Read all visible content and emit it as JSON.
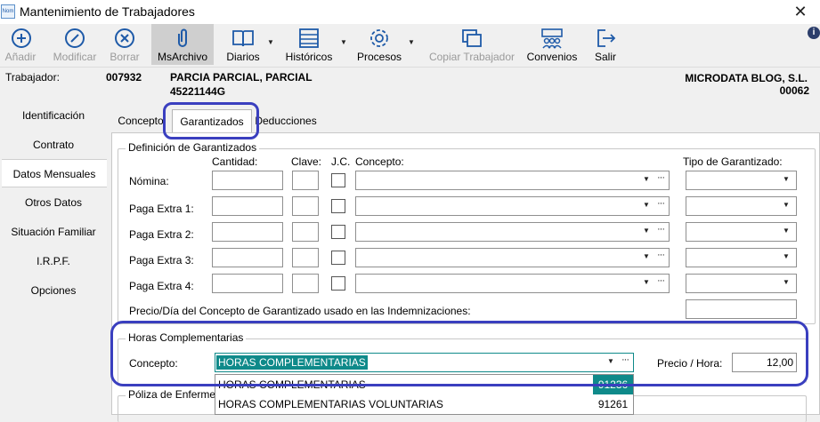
{
  "window": {
    "app_icon_text": "Nom",
    "title": "Mantenimiento de Trabajadores"
  },
  "toolbar": {
    "buttons": [
      {
        "label": "Añadir",
        "icon": "plus-circle-icon",
        "enabled": false
      },
      {
        "label": "Modificar",
        "icon": "pencil-icon",
        "enabled": false
      },
      {
        "label": "Borrar",
        "icon": "x-circle-icon",
        "enabled": false
      },
      {
        "label": "MsArchivo",
        "icon": "paperclip-icon",
        "enabled": true
      },
      {
        "label": "Diarios",
        "icon": "book-icon",
        "enabled": true
      },
      {
        "label": "Históricos",
        "icon": "list-icon",
        "enabled": true
      },
      {
        "label": "Procesos",
        "icon": "gear-icon",
        "enabled": true
      },
      {
        "label": "Copiar Trabajador",
        "icon": "copy-icon",
        "enabled": false
      },
      {
        "label": "Convenios",
        "icon": "group-icon",
        "enabled": true
      },
      {
        "label": "Salir",
        "icon": "exit-icon",
        "enabled": true
      }
    ]
  },
  "worker": {
    "label": "Trabajador:",
    "code": "007932",
    "name": "PARCIA PARCIAL, PARCIAL",
    "nif": "45221144G",
    "company": "MICRODATA BLOG, S.L.",
    "company_code": "00062"
  },
  "sidebar": {
    "items": [
      {
        "label": "Identificación"
      },
      {
        "label": "Contrato"
      },
      {
        "label": "Datos Mensuales"
      },
      {
        "label": "Otros Datos"
      },
      {
        "label": "Situación Familiar"
      },
      {
        "label": "I.R.P.F."
      },
      {
        "label": "Opciones"
      }
    ]
  },
  "tabs": [
    {
      "label": "Concepto"
    },
    {
      "label": "Garantizados"
    },
    {
      "label": "Deducciones"
    }
  ],
  "garantizados": {
    "title": "Definición de Garantizados",
    "headers": {
      "cantidad": "Cantidad:",
      "clave": "Clave:",
      "jc": "J.C.",
      "concepto": "Concepto:",
      "tipo": "Tipo de Garantizado:"
    },
    "rows": [
      {
        "label": "Nómina:"
      },
      {
        "label": "Paga Extra 1:"
      },
      {
        "label": "Paga Extra 2:"
      },
      {
        "label": "Paga Extra 3:"
      },
      {
        "label": "Paga Extra 4:"
      }
    ],
    "indemnizaciones_label": "Precio/Día del Concepto de Garantizado usado en las Indemnizaciones:"
  },
  "horas": {
    "title": "Horas Complementarias",
    "concepto_label": "Concepto:",
    "concepto_value": "HORAS COMPLEMENTARIAS",
    "precio_label": "Precio / Hora:",
    "precio_value": "12,00"
  },
  "poliza": {
    "title": "Póliza de Enfermedad"
  },
  "dropdown": {
    "options": [
      {
        "name": "HORAS COMPLEMENTARIAS",
        "code": "91236"
      },
      {
        "name": "HORAS COMPLEMENTARIAS VOLUNTARIAS",
        "code": "91261"
      }
    ]
  },
  "colors": {
    "highlight": "#3a3fbf",
    "selection": "#0f8a8a"
  }
}
